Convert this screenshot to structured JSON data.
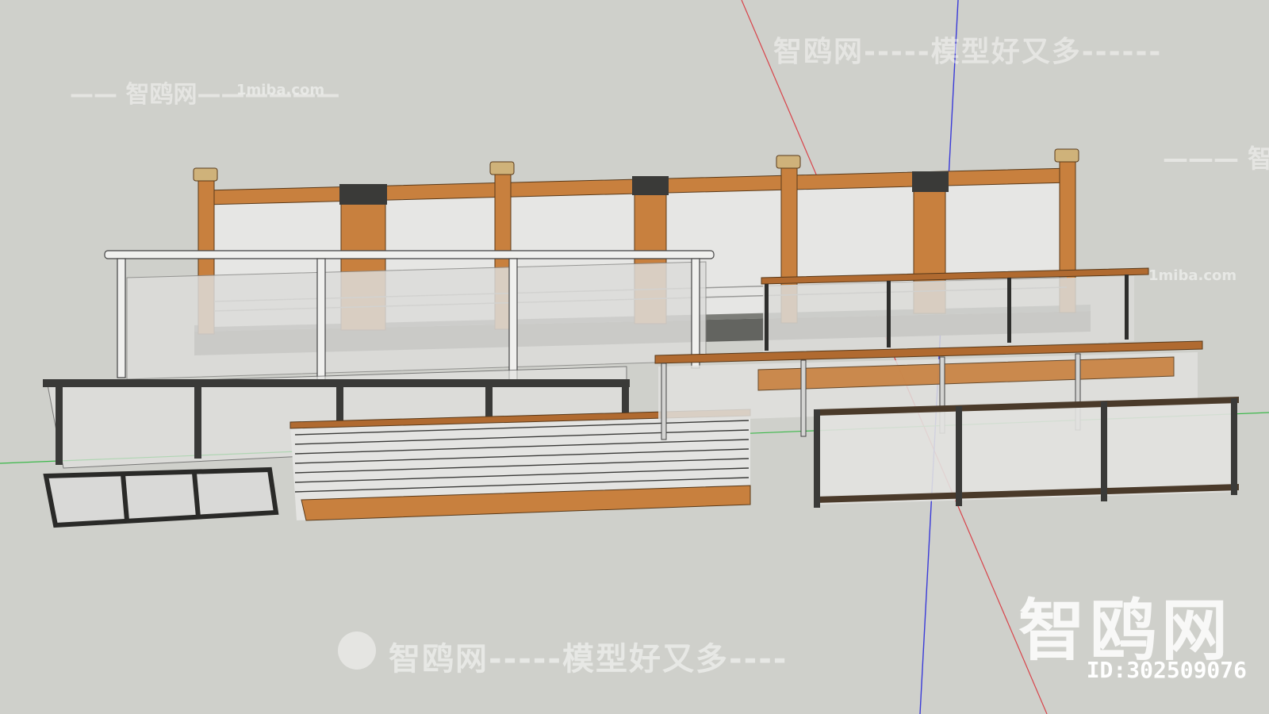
{
  "app": {
    "viewport_background": "#cfd0cb"
  },
  "watermarks": {
    "top": "智鸥网-----模型好又多------",
    "left": "—— 智鸥网——————",
    "site_left": "1miba.com",
    "right": "——— 智鸥网—",
    "site_right": "1miba.com",
    "bottom": "智鸥网-----模型好又多----",
    "big": "智鸥网",
    "id": "ID:302509076"
  },
  "axes": {
    "red": "#d8434a",
    "green": "#3cb84a",
    "blue": "#3a3ad8"
  },
  "materials": {
    "wood": "#c8803e",
    "wood_dark": "#8a5424",
    "concrete": "#636460",
    "steel": "#3a3a38",
    "chrome": "#f0f0ee",
    "glass": "#e4e4e2",
    "rail_wood": "#b06a30"
  },
  "models": [
    {
      "name": "wood-post-railing-with-concrete-base"
    },
    {
      "name": "chrome-glass-railing"
    },
    {
      "name": "black-steel-railing"
    },
    {
      "name": "steel-frame-panel"
    },
    {
      "name": "cable-railing-with-wood-base"
    },
    {
      "name": "wood-handrail-glass-railing-back"
    },
    {
      "name": "wood-handrail-glass-railing-front"
    },
    {
      "name": "dark-frame-glass-railing"
    }
  ]
}
